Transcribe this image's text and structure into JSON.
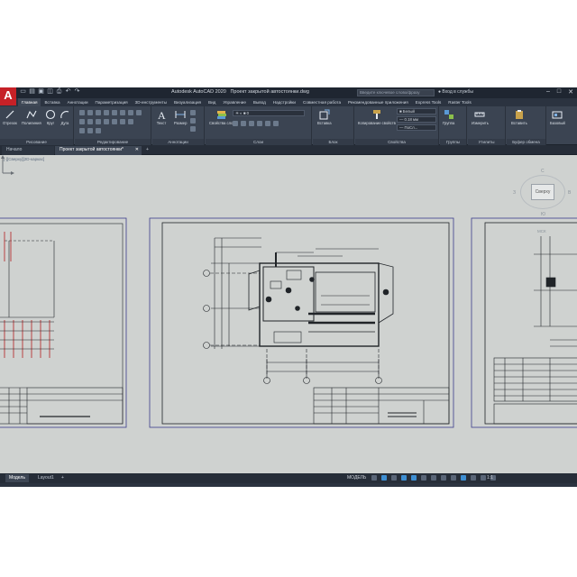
{
  "title_bar": {
    "app_title": "Autodesk AutoCAD 2020",
    "file_name": "Проект закрытой автостоянки.dwg",
    "search_placeholder": "Введите ключевое слово/фразу",
    "user_label": "Вход в службы",
    "logo_letter": "A"
  },
  "ribbon_tabs": [
    "Главная",
    "Вставка",
    "Аннотации",
    "Параметризация",
    "3D-инструменты",
    "Визуализация",
    "Вид",
    "Управление",
    "Вывод",
    "Надстройки",
    "Совместная работа",
    "Рекомендованные приложения",
    "Express Tools",
    "Raster Tools"
  ],
  "active_tab_index": 0,
  "ribbon": {
    "draw": {
      "title": "Рисование",
      "buttons": [
        "Отрезок",
        "Полилиния",
        "Круг",
        "Дуга"
      ]
    },
    "modify": {
      "title": "Редактирование"
    },
    "annotation": {
      "title": "Аннотации",
      "buttons": [
        "Текст",
        "Размер"
      ]
    },
    "layers": {
      "title": "Слои",
      "properties_button": "Свойства слоя"
    },
    "block": {
      "title": "Блок",
      "button": "Вставка"
    },
    "properties": {
      "title": "Свойства",
      "copy_button": "Копирование свойств",
      "color_value": "Белый",
      "lineweight_value": "0.18 мм",
      "linetype_value": "ПоСл..."
    },
    "groups": {
      "title": "Группы",
      "button": "Группа"
    },
    "utilities": {
      "title": "Утилиты",
      "button": "Измерить"
    },
    "clipboard": {
      "title": "Буфер обмена",
      "button": "Вставить"
    },
    "view": {
      "button": "Базовый"
    }
  },
  "doc_tabs": {
    "start": "Начало",
    "drawing": "Проект закрытой автостоянки*",
    "add": "+"
  },
  "viewport": {
    "label": "[-][Сверху][2D-каркас]",
    "viewcube_face": "Сверху",
    "compass": {
      "north": "С",
      "south": "Ю",
      "west": "З",
      "east": "В"
    },
    "wcs_label": "МСК"
  },
  "layout_tabs": [
    "Модель",
    "Layout1",
    "+"
  ],
  "status_bar": {
    "mode": "МОДЕЛЬ",
    "scale": "1:1"
  },
  "colors": {
    "app_bg": "#2b3340",
    "ribbon_bg": "#3b4452",
    "workspace_bg": "#cfd2d0",
    "accent_blue": "#3d8ed2",
    "logo_red": "#c62127"
  }
}
